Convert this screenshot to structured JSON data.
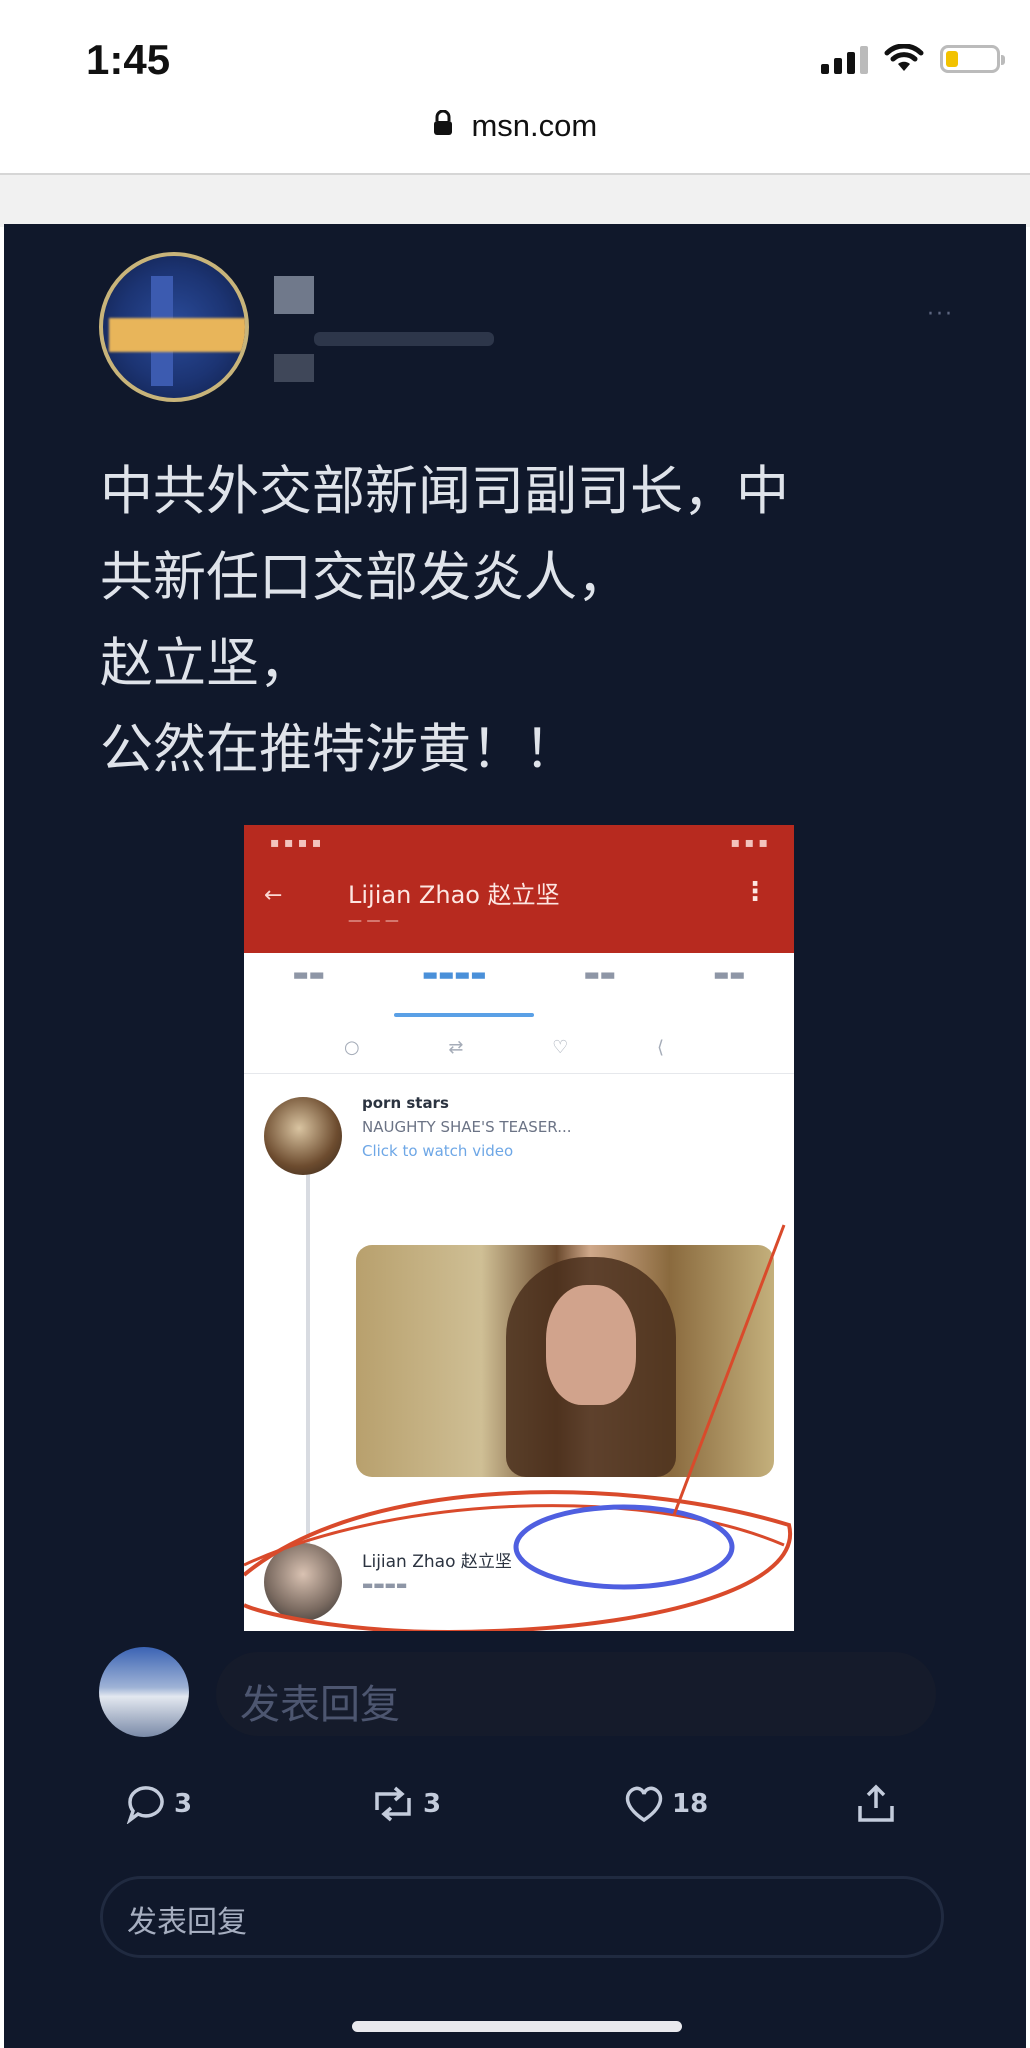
{
  "status_bar": {
    "time": "1:45",
    "battery_level": 0.25
  },
  "browser": {
    "url": "msn.com"
  },
  "post": {
    "lines": [
      "中共外交部新闻司副司长，中",
      "共新任口交部发炎人，",
      "赵立坚，",
      "公然在推特涉黄！！"
    ]
  },
  "embedded_screenshot": {
    "header_title": "Lijian Zhao 赵立坚",
    "user1": "porn stars",
    "tweet1_text": "NAUGHTY SHAE'S TEASER...",
    "tweet1_link": "Click to watch video",
    "user2": "Lijian Zhao 赵立坚"
  },
  "reply": {
    "placeholder": "发表回复"
  },
  "actions": {
    "reply_count": "3",
    "retweet_count": "3",
    "like_count": "18"
  },
  "reply_box": {
    "label": "发表回复"
  },
  "colors": {
    "background": "#10182b",
    "header_red": "#b72a1f",
    "accent_blue": "#4a90d9"
  },
  "icons": [
    "lock-icon",
    "signal-icon",
    "wifi-icon",
    "battery-icon",
    "reply-icon",
    "retweet-icon",
    "heart-icon",
    "share-icon"
  ]
}
